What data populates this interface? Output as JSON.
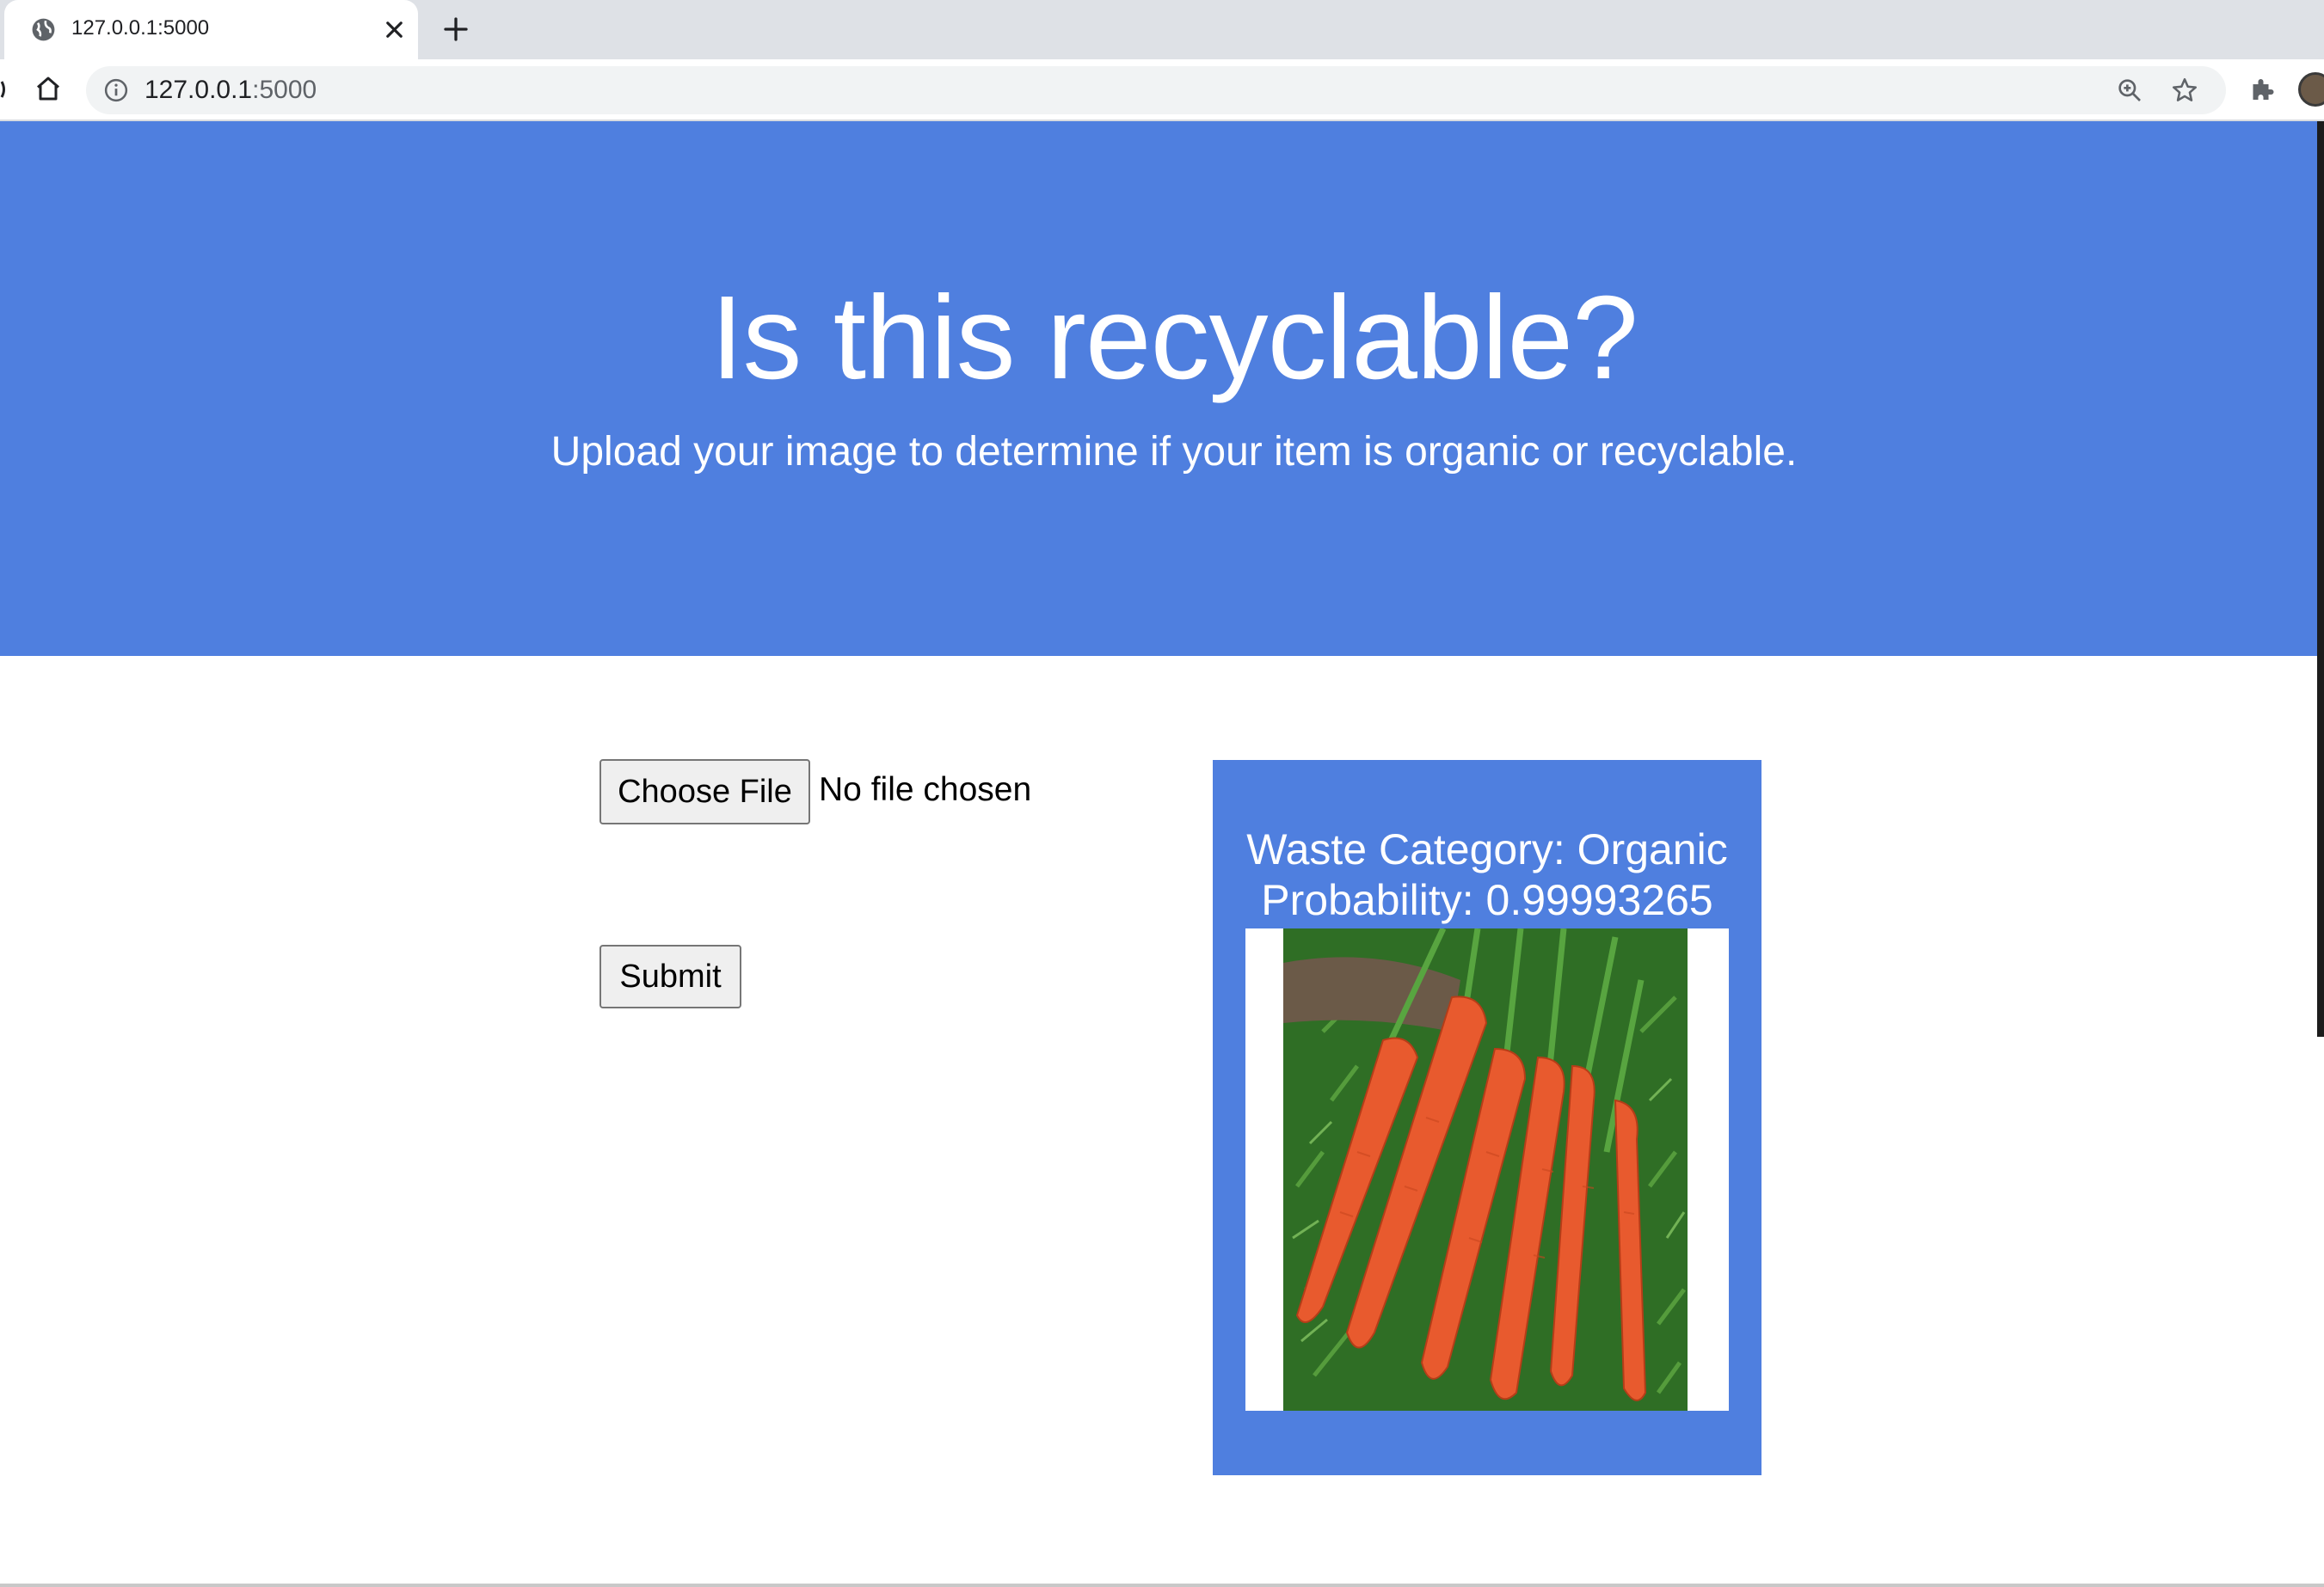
{
  "browser": {
    "tab_title": "127.0.0.1:5000",
    "url_host": "127.0.0.1",
    "url_port": ":5000"
  },
  "hero": {
    "title": "Is this recyclable?",
    "subtitle": "Upload your image to determine if your item is organic or recyclable."
  },
  "upload": {
    "choose_file_label": "Choose File",
    "file_status": "No file chosen",
    "submit_label": "Submit"
  },
  "result": {
    "category_text": "Waste Category: Organic",
    "probability_text": "Probability: 0.99993265"
  },
  "colors": {
    "accent": "#4f7fdf",
    "carrot": "#e85a2e",
    "foliage": "#2f6e25"
  },
  "icons": [
    "globe-icon",
    "close-icon",
    "plus-icon",
    "home-icon",
    "info-icon",
    "zoom-icon",
    "star-icon",
    "puzzle-icon"
  ]
}
